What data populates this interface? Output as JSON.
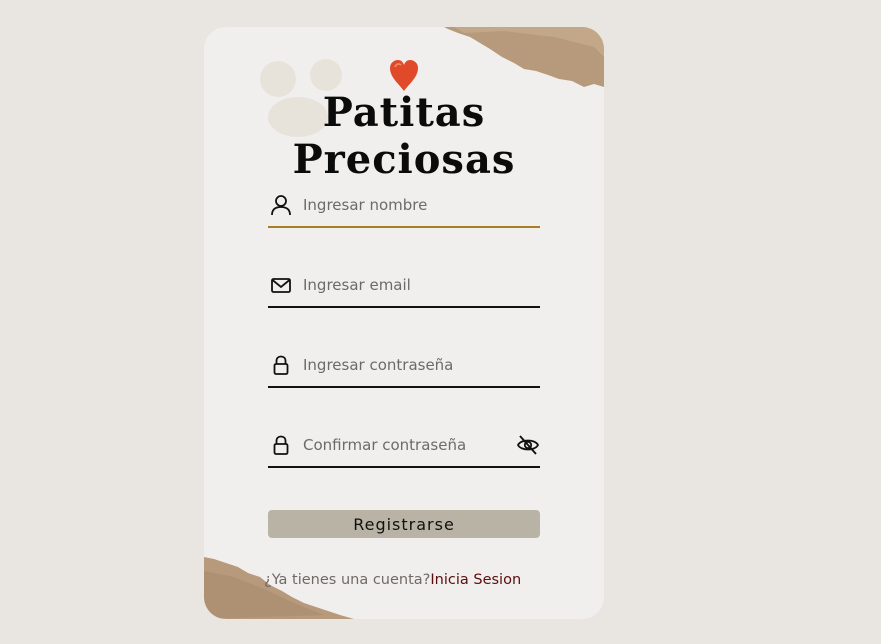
{
  "brand": {
    "title": "Patitas Preciosas",
    "heart_color": "#e04a2a"
  },
  "form": {
    "name": {
      "placeholder": "Ingresar nombre",
      "icon": "user-icon"
    },
    "email": {
      "placeholder": "Ingresar email",
      "icon": "mail-icon"
    },
    "password": {
      "placeholder": "Ingresar contraseña",
      "icon": "lock-icon"
    },
    "confirm": {
      "placeholder": "Confirmar contraseña",
      "icon": "lock-icon",
      "toggle_icon": "eye-off-icon"
    },
    "submit_label": "Registrarse"
  },
  "footer": {
    "prompt": "¿Ya tienes una cuenta?",
    "link": "Inicia Sesion"
  },
  "colors": {
    "page_bg": "#e9e5e0",
    "card_bg": "#f1efed",
    "button_bg": "#b9b3a5",
    "active_underline": "#a87d24",
    "link": "#5a0d0d"
  }
}
